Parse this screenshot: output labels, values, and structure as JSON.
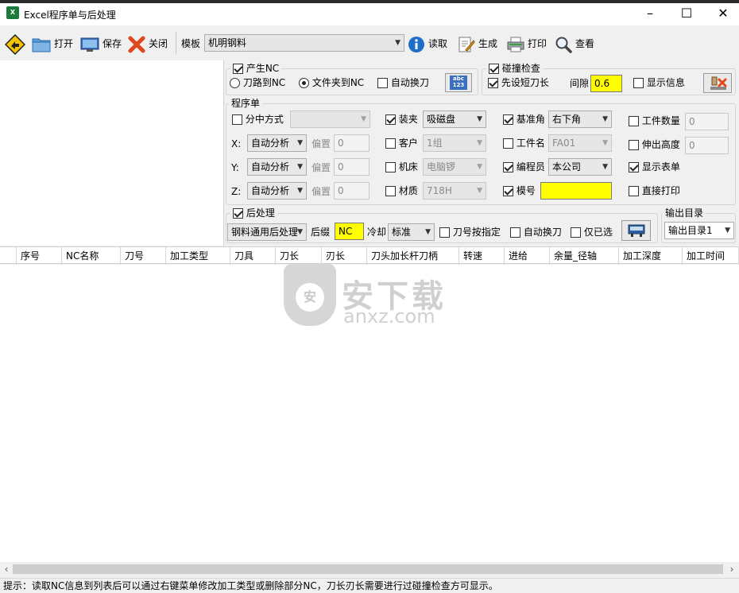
{
  "window": {
    "title": "Excel程序单与后处理",
    "minimize": "–",
    "maximize": "☐",
    "close": "✕"
  },
  "toolbar": {
    "open": "打开",
    "save": "保存",
    "close": "关闭",
    "template_label": "模板",
    "template_value": "机明钢料",
    "read": "读取",
    "generate": "生成",
    "print": "打印",
    "view": "查看"
  },
  "produce_nc": {
    "title": "产生NC",
    "checked": true,
    "option_path_to_nc": "刀路到NC",
    "option_folder_to_nc": "文件夹到NC",
    "auto_tool_change": "自动换刀",
    "icon_text_top": "abc",
    "icon_text_bottom": "123"
  },
  "collision_check": {
    "title": "碰撞检查",
    "checked": true,
    "short_tool_first": "先设短刀长",
    "gap_label": "间隙",
    "gap_value": "0.6",
    "show_info": "显示信息"
  },
  "program_sheet": {
    "title": "程序单",
    "center_mode": "分中方式",
    "x_label": "X:",
    "y_label": "Y:",
    "z_label": "Z:",
    "axis_mode": "自动分析",
    "offset_label": "偏置",
    "offset_value": "0",
    "clamp_label": "装夹",
    "clamp_value": "吸磁盘",
    "customer_label": "客户",
    "customer_value": "1组",
    "machine_label": "机床",
    "machine_value": "电脑锣",
    "material_label": "材质",
    "material_value": "718H",
    "ref_corner_label": "基准角",
    "ref_corner_value": "右下角",
    "part_name_label": "工件名",
    "part_name_value": "FA01",
    "programmer_label": "编程员",
    "programmer_value": "本公司",
    "mold_no_label": "模号",
    "mold_no_value": "",
    "part_qty_label": "工件数量",
    "part_qty_value": "0",
    "extend_height_label": "伸出高度",
    "extend_height_value": "0",
    "show_sheet_label": "显示表单",
    "direct_print_label": "直接打印"
  },
  "post_process": {
    "title": "后处理",
    "post_value": "钢料通用后处理",
    "suffix_label": "后缀",
    "suffix_value": "NC",
    "coolant_label": "冷却",
    "coolant_value": "标准",
    "tool_no_specified": "刀号按指定",
    "auto_tool_change": "自动换刀",
    "selected_only": "仅已选"
  },
  "output_dir": {
    "title": "输出目录",
    "value": "输出目录1"
  },
  "grid": {
    "columns": [
      "序号",
      "NC名称",
      "刀号",
      "加工类型",
      "刀具",
      "刀长",
      "刃长",
      "刀头加长杆刀柄",
      "转速",
      "进给",
      "余量_径轴",
      "加工深度",
      "加工时间"
    ]
  },
  "watermark": {
    "text": "安下载",
    "sub": "anxz.com",
    "shield_text": "安"
  },
  "status": {
    "text": "提示：读取NC信息到列表后可以通过右键菜单修改加工类型或删除部分NC，刀长刃长需要进行过碰撞检查方可显示。"
  },
  "scrollbar": {
    "left": "‹",
    "right": "›"
  },
  "colors": {
    "highlight_yellow": "#ffff00",
    "app_icon_green": "#1e7a3c"
  }
}
